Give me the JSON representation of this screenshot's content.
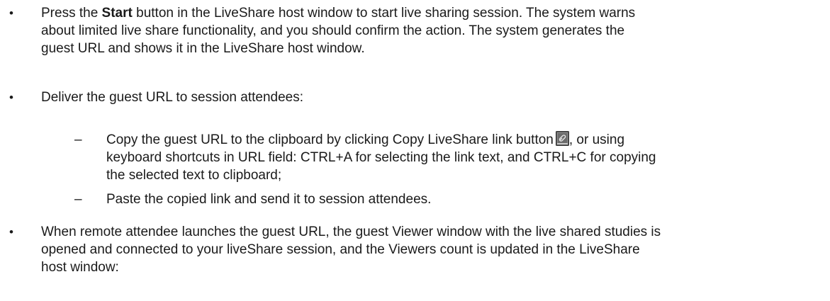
{
  "bullets": [
    {
      "line1_pre": "Press the ",
      "line1_bold": "Start",
      "line1_post": " button in the LiveShare host window to start live sharing session. The system warns",
      "line2": "about limited live share functionality, and you should confirm the action. The system generates the",
      "line3": "guest URL and shows it in the LiveShare host window."
    },
    {
      "line1": "Deliver the guest URL to session attendees:"
    },
    {
      "line1": "When remote attendee launches the guest URL, the guest Viewer window with the live shared studies is",
      "line2": "opened and connected to your liveShare session, and the Viewers count is updated in the LiveShare",
      "line3": "host window:"
    }
  ],
  "sub_bullets": [
    {
      "line1_pre": "Copy the guest URL to the clipboard by clicking Copy LiveShare link button",
      "line1_post": ", or using",
      "line2": "keyboard shortcuts in URL field: CTRL+A for selecting the link text, and CTRL+C for copying",
      "line3": "the selected text to clipboard;",
      "icon": "copy-liveshare-link-icon"
    },
    {
      "line1": "Paste the copied link and send it to session attendees."
    }
  ],
  "symbols": {
    "bullet": "•",
    "dash": "–"
  }
}
